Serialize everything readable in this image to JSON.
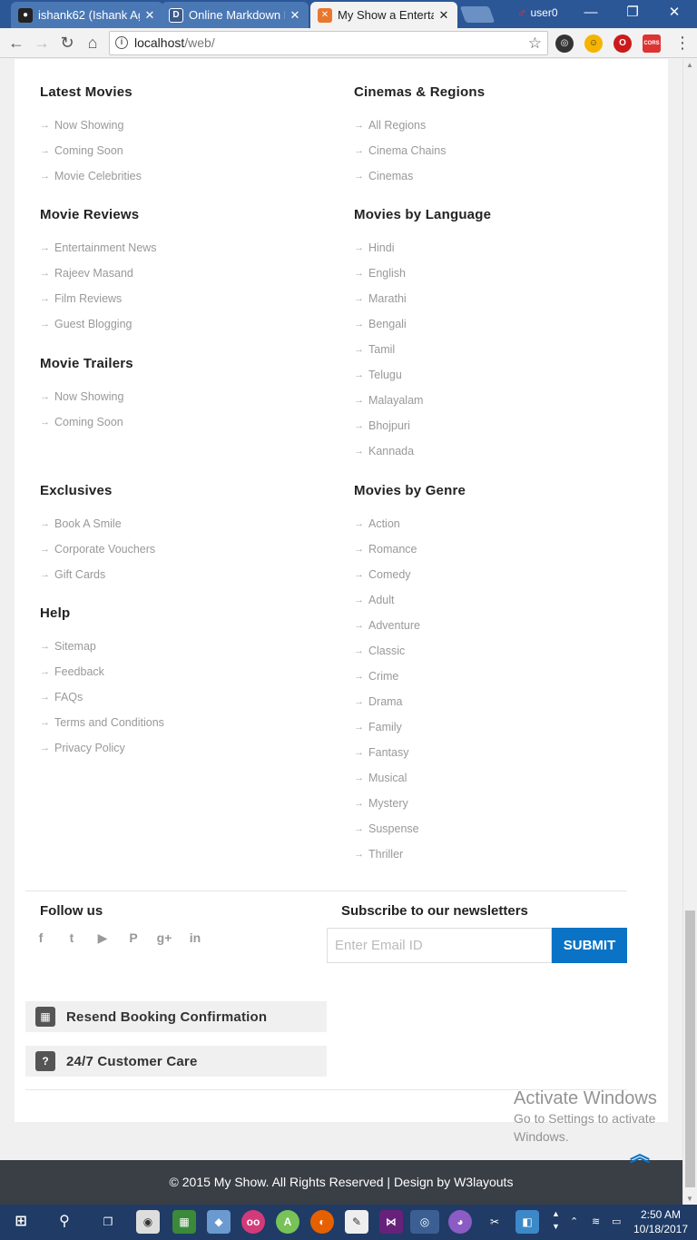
{
  "browser": {
    "tabs": [
      {
        "title": "ishank62 (Ishank Ag",
        "close": "✕"
      },
      {
        "title": "Online Markdown E",
        "close": "✕"
      },
      {
        "title": "My Show a Entertai",
        "close": "✕"
      }
    ],
    "user_label": "user0",
    "window_controls": {
      "minimize": "—",
      "restore": "❐",
      "close": "✕"
    },
    "url_host": "localhost",
    "url_path": "/web/",
    "extension_cors_label": "CORS"
  },
  "footer_links": {
    "left": [
      {
        "title": "Latest Movies",
        "items": [
          "Now Showing",
          "Coming Soon",
          "Movie Celebrities"
        ]
      },
      {
        "title": "Movie Reviews",
        "items": [
          "Entertainment News",
          "Rajeev Masand",
          "Film Reviews",
          "Guest Blogging"
        ]
      },
      {
        "title": "Movie Trailers",
        "items": [
          "Now Showing",
          "Coming Soon"
        ]
      },
      {
        "title": "Exclusives",
        "items": [
          "Book A Smile",
          "Corporate Vouchers",
          "Gift Cards"
        ]
      },
      {
        "title": "Help",
        "items": [
          "Sitemap",
          "Feedback",
          "FAQs",
          "Terms and Conditions",
          "Privacy Policy"
        ]
      }
    ],
    "right": [
      {
        "title": "Cinemas & Regions",
        "items": [
          "All Regions",
          "Cinema Chains",
          "Cinemas"
        ]
      },
      {
        "title": "Movies by Language",
        "items": [
          "Hindi",
          "English",
          "Marathi",
          "Bengali",
          "Tamil",
          "Telugu",
          "Malayalam",
          "Bhojpuri",
          "Kannada"
        ]
      },
      {
        "title": "Movies by Genre",
        "items": [
          "Action",
          "Romance",
          "Comedy",
          "Adult",
          "Adventure",
          "Classic",
          "Crime",
          "Drama",
          "Family",
          "Fantasy",
          "Musical",
          "Mystery",
          "Suspense",
          "Thriller"
        ]
      }
    ]
  },
  "follow": {
    "title": "Follow us",
    "icons": [
      "facebook-icon",
      "twitter-icon",
      "youtube-icon",
      "pinterest-icon",
      "google-plus-icon",
      "linkedin-icon"
    ],
    "glyphs": [
      "f",
      "t",
      "▶",
      "P",
      "g+",
      "in"
    ]
  },
  "newsletter": {
    "title": "Subscribe to our newsletters",
    "placeholder": "Enter Email ID",
    "submit_label": "SUBMIT"
  },
  "actions": {
    "resend_label": "Resend Booking Confirmation",
    "care_label": "24/7 Customer Care",
    "care_glyph": "?"
  },
  "watermark": {
    "line1": "Activate Windows",
    "line2": "Go to Settings to activate",
    "line3": "Windows."
  },
  "footer": {
    "copyright": "© 2015 My Show. All Rights Reserved | Design by W3layouts"
  },
  "taskbar": {
    "time": "2:50 AM",
    "date": "10/18/2017"
  },
  "colors": {
    "accent": "#0a73c5",
    "footer_bg": "#3a3e45",
    "taskbar_bg": "#1f3b66"
  }
}
